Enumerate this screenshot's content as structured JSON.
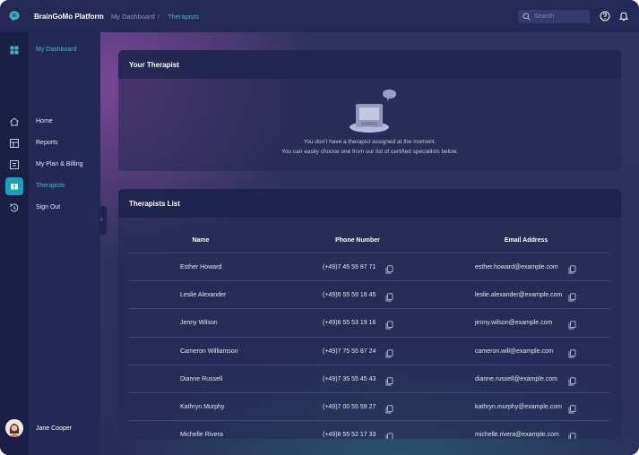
{
  "app": {
    "name": "BrainGoMo Platform"
  },
  "breadcrumb": {
    "items": [
      "My Dashboard",
      "Therapists"
    ],
    "separator": "/"
  },
  "search": {
    "placeholder": "Search"
  },
  "sidebar": {
    "section_title": "My Dashboard",
    "items": [
      {
        "label": "Home",
        "icon": "home-icon"
      },
      {
        "label": "Reports",
        "icon": "reports-icon"
      },
      {
        "label": "My Plan & Billing",
        "icon": "billing-icon"
      },
      {
        "label": "Therapists",
        "icon": "therapists-icon",
        "active": true
      },
      {
        "label": "Sign Out",
        "icon": "sign-out-icon"
      }
    ],
    "collapse_glyph": "‹",
    "user": {
      "name": "Jane Cooper"
    }
  },
  "your_therapist": {
    "title": "Your Therapist",
    "empty_line1": "You don't have a therapist assigned at the moment.",
    "empty_line2": "You can easily choose one from our list of certified specialists below."
  },
  "therapists_list": {
    "title": "Therapists List",
    "columns": [
      "Name",
      "Phone Number",
      "Email Address"
    ],
    "rows": [
      {
        "name": "Esther Howard",
        "phone": "(+49)7 45 55 87 71",
        "email": "esther.howard@example.com"
      },
      {
        "name": "Leslie Alexander",
        "phone": "(+49)6 55 59 16 45",
        "email": "leslie.alexander@example.com"
      },
      {
        "name": "Jenny Wilson",
        "phone": "(+49)6 55 53 19 16",
        "email": "jenny.wilson@example.com"
      },
      {
        "name": "Cameron Williamson",
        "phone": "(+49)7 75 55 87 24",
        "email": "cameron.will@example.com"
      },
      {
        "name": "Dianne Russell",
        "phone": "(+49)7 35 55 45 43",
        "email": "dianne.russell@example.com"
      },
      {
        "name": "Kathryn Murphy",
        "phone": "(+49)7 00 55 59 27",
        "email": "kathryn.murphy@example.com"
      },
      {
        "name": "Michelle Rivera",
        "phone": "(+49)6 55 52 17 33",
        "email": "michelle.rivera@example.com"
      }
    ]
  },
  "colors": {
    "accent": "#17a2b8",
    "active_text": "#3fbdcc",
    "panel": "#242a55"
  }
}
